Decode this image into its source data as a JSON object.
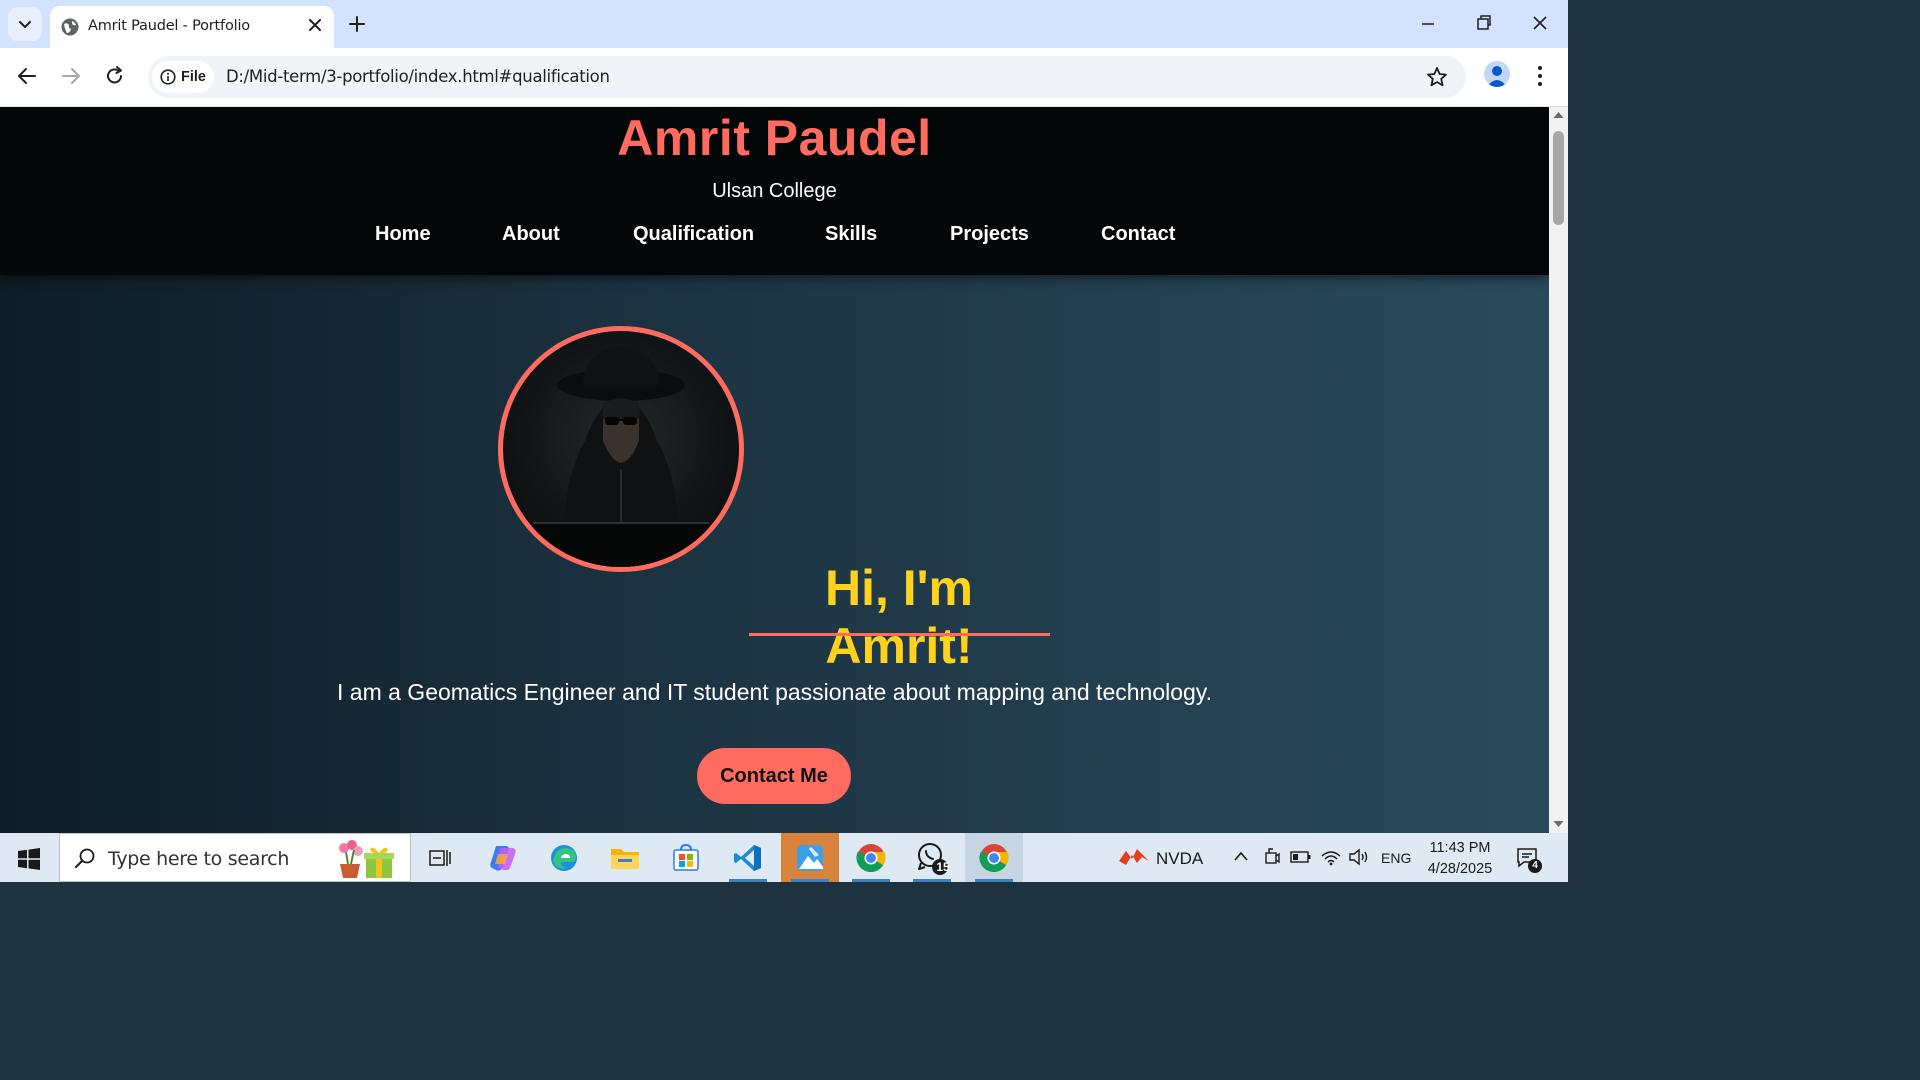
{
  "browser": {
    "tab_title": "Amrit Paudel - Portfolio",
    "security_chip": "File",
    "url": "D:/Mid-term/3-portfolio/index.html#qualification"
  },
  "site": {
    "name": "Amrit Paudel",
    "subtitle": "Ulsan College",
    "nav": {
      "home": "Home",
      "about": "About",
      "qualification": "Qualification",
      "skills": "Skills",
      "projects": "Projects",
      "contact": "Contact"
    },
    "hero": {
      "greeting": "Hi, I'm Amrit!",
      "intro": "I am a Geomatics Engineer and IT student passionate about mapping and technology.",
      "cta": "Contact Me"
    },
    "colors": {
      "accent": "#ff6b5e",
      "greeting": "#ffd21e",
      "header_bg": "#040708"
    }
  },
  "taskbar": {
    "search_placeholder": "Type here to search",
    "nvda_label": "NVDA",
    "language": "ENG",
    "time": "11:43 PM",
    "date": "4/28/2025",
    "whatsapp_badge": "15",
    "notification_count": "4",
    "icons": [
      "windows-start-icon",
      "search-icon",
      "task-view-icon",
      "copilot-icon",
      "edge-icon",
      "file-explorer-icon",
      "ms-store-icon",
      "vscode-icon",
      "photos-icon",
      "chrome-icon",
      "whatsapp-icon",
      "chrome-icon"
    ]
  }
}
